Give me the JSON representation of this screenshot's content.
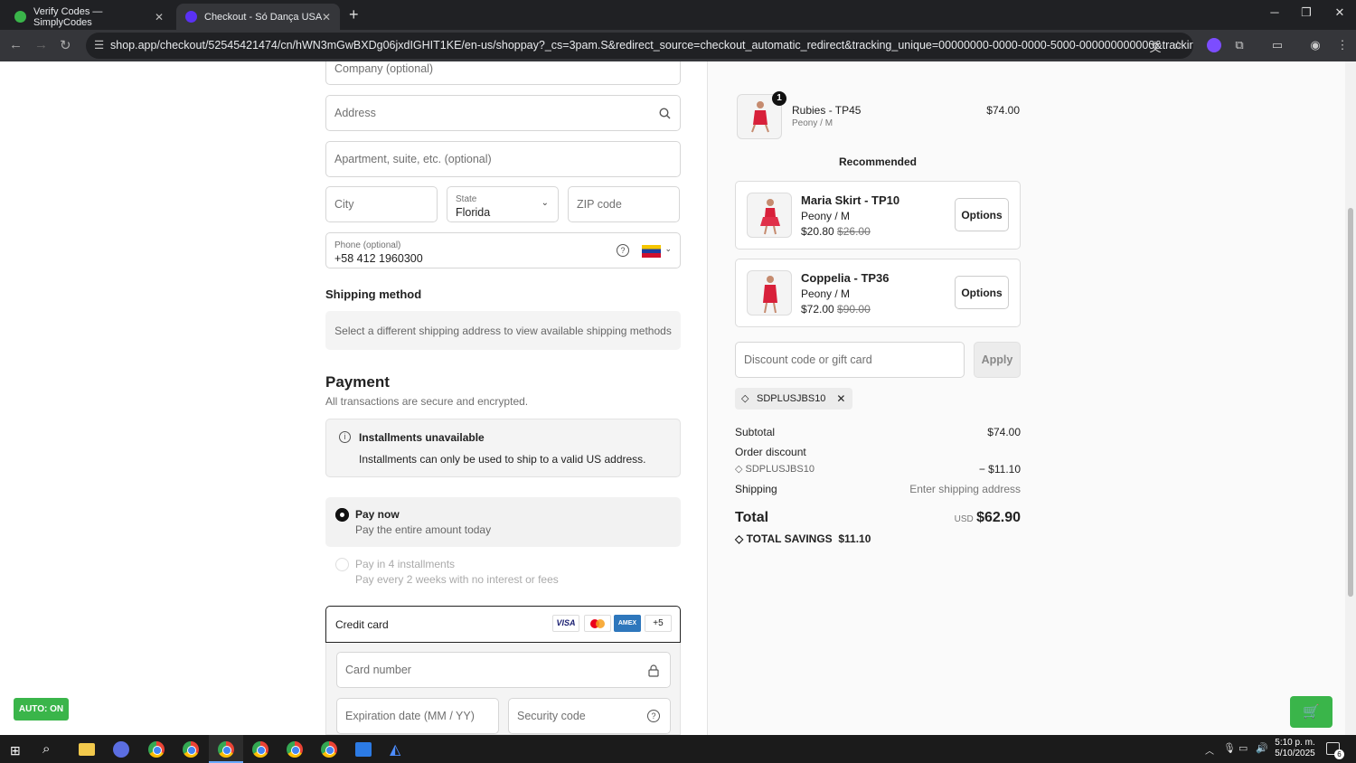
{
  "browser": {
    "tabs": [
      {
        "label": "Verify Codes — SimplyCodes",
        "active": false
      },
      {
        "label": "Checkout - Só Dança USA",
        "active": true
      }
    ],
    "url": "shop.app/checkout/52545421474/cn/hWN3mGwBXDg06jxdIGHIT1KE/en-us/shoppay?_cs=3pam.S&redirect_source=checkout_automatic_redirect&tracking_unique=00000000-0000-0000-5000-000000000000&tracking_visit=0000000-..."
  },
  "form": {
    "company_placeholder": "Company (optional)",
    "address_placeholder": "Address",
    "apartment_placeholder": "Apartment, suite, etc. (optional)",
    "city_placeholder": "City",
    "state_label": "State",
    "state_value": "Florida",
    "zip_placeholder": "ZIP code",
    "phone_label": "Phone (optional)",
    "phone_value": "+58 412 1960300"
  },
  "shipping": {
    "title": "Shipping method",
    "message": "Select a different shipping address to view available shipping methods"
  },
  "payment": {
    "title": "Payment",
    "subtitle": "All transactions are secure and encrypted.",
    "installments_title": "Installments unavailable",
    "installments_msg": "Installments can only be used to ship to a valid US address.",
    "paynow_title": "Pay now",
    "paynow_sub": "Pay the entire amount today",
    "pay4_title": "Pay in 4 installments",
    "pay4_sub": "Pay every 2 weeks with no interest or fees",
    "credit_card": "Credit card",
    "card_brands": [
      "VISA",
      "AMEX"
    ],
    "more_brands": "+5",
    "card_number_placeholder": "Card number",
    "expiry_placeholder": "Expiration date (MM / YY)",
    "security_placeholder": "Security code"
  },
  "order": {
    "item": {
      "qty": "1",
      "name": "Rubies - TP45",
      "variant": "Peony / M",
      "price": "$74.00"
    },
    "recommended_title": "Recommended",
    "recommended": [
      {
        "name": "Maria Skirt - TP10",
        "variant": "Peony / M",
        "price": "$20.80",
        "old_price": "$26.00",
        "button": "Options"
      },
      {
        "name": "Coppelia - TP36",
        "variant": "Peony / M",
        "price": "$72.00",
        "old_price": "$90.00",
        "button": "Options"
      }
    ],
    "discount_placeholder": "Discount code or gift card",
    "apply": "Apply",
    "code_tag": "SDPLUSJBS10",
    "subtotal_label": "Subtotal",
    "subtotal": "$74.00",
    "order_discount_label": "Order discount",
    "discount_code": "SDPLUSJBS10",
    "discount_amount": "− $11.10",
    "shipping_label": "Shipping",
    "shipping_value": "Enter shipping address",
    "total_label": "Total",
    "currency": "USD",
    "total": "$62.90",
    "savings_label": "TOTAL SAVINGS",
    "savings": "$11.10"
  },
  "extension": {
    "auto_label": "AUTO: ON"
  },
  "taskbar": {
    "time": "5:10 p. m.",
    "date": "5/10/2025",
    "notif": "6"
  },
  "colors": {
    "accent_green": "#3ab54a",
    "total_text": "#222222"
  }
}
